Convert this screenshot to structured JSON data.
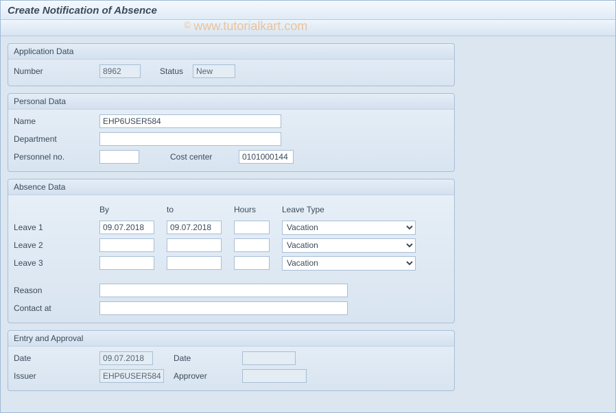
{
  "title": "Create Notification of Absence",
  "watermark": "www.tutorialkart.com",
  "app": {
    "title": "Application Data",
    "number_label": "Number",
    "number_value": "8962",
    "status_label": "Status",
    "status_value": "New"
  },
  "personal": {
    "title": "Personal Data",
    "name_label": "Name",
    "name_value": "EHP6USER584",
    "department_label": "Department",
    "department_value": "",
    "personnel_label": "Personnel no.",
    "personnel_value": "",
    "costcenter_label": "Cost center",
    "costcenter_value": "0101000144"
  },
  "absence": {
    "title": "Absence Data",
    "hdr_by": "By",
    "hdr_to": "to",
    "hdr_hours": "Hours",
    "hdr_type": "Leave Type",
    "rows": [
      {
        "label": "Leave 1",
        "by": "09.07.2018",
        "to": "09.07.2018",
        "hours": "",
        "type": "Vacation"
      },
      {
        "label": "Leave 2",
        "by": "",
        "to": "",
        "hours": "",
        "type": "Vacation"
      },
      {
        "label": "Leave 3",
        "by": "",
        "to": "",
        "hours": "",
        "type": "Vacation"
      }
    ],
    "reason_label": "Reason",
    "reason_value": "",
    "contact_label": "Contact at",
    "contact_value": ""
  },
  "entry": {
    "title": "Entry and Approval",
    "date_label": "Date",
    "date_value": "09.07.2018",
    "date2_label": "Date",
    "date2_value": "",
    "issuer_label": "Issuer",
    "issuer_value": "EHP6USER584",
    "approver_label": "Approver",
    "approver_value": ""
  }
}
